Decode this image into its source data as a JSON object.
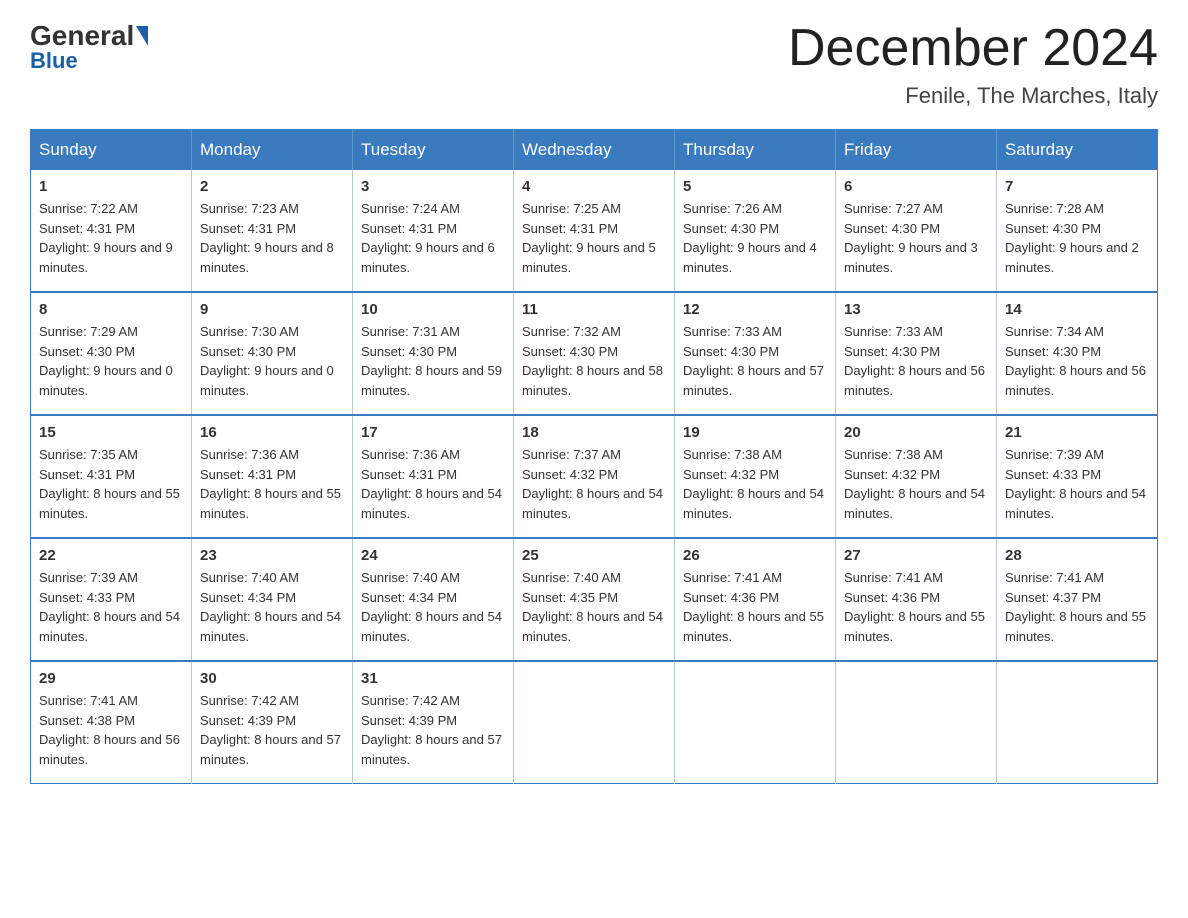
{
  "header": {
    "logo_general": "General",
    "logo_blue": "Blue",
    "month_year": "December 2024",
    "location": "Fenile, The Marches, Italy"
  },
  "days_of_week": [
    "Sunday",
    "Monday",
    "Tuesday",
    "Wednesday",
    "Thursday",
    "Friday",
    "Saturday"
  ],
  "weeks": [
    [
      {
        "day": "1",
        "sunrise": "7:22 AM",
        "sunset": "4:31 PM",
        "daylight": "9 hours and 9 minutes."
      },
      {
        "day": "2",
        "sunrise": "7:23 AM",
        "sunset": "4:31 PM",
        "daylight": "9 hours and 8 minutes."
      },
      {
        "day": "3",
        "sunrise": "7:24 AM",
        "sunset": "4:31 PM",
        "daylight": "9 hours and 6 minutes."
      },
      {
        "day": "4",
        "sunrise": "7:25 AM",
        "sunset": "4:31 PM",
        "daylight": "9 hours and 5 minutes."
      },
      {
        "day": "5",
        "sunrise": "7:26 AM",
        "sunset": "4:30 PM",
        "daylight": "9 hours and 4 minutes."
      },
      {
        "day": "6",
        "sunrise": "7:27 AM",
        "sunset": "4:30 PM",
        "daylight": "9 hours and 3 minutes."
      },
      {
        "day": "7",
        "sunrise": "7:28 AM",
        "sunset": "4:30 PM",
        "daylight": "9 hours and 2 minutes."
      }
    ],
    [
      {
        "day": "8",
        "sunrise": "7:29 AM",
        "sunset": "4:30 PM",
        "daylight": "9 hours and 0 minutes."
      },
      {
        "day": "9",
        "sunrise": "7:30 AM",
        "sunset": "4:30 PM",
        "daylight": "9 hours and 0 minutes."
      },
      {
        "day": "10",
        "sunrise": "7:31 AM",
        "sunset": "4:30 PM",
        "daylight": "8 hours and 59 minutes."
      },
      {
        "day": "11",
        "sunrise": "7:32 AM",
        "sunset": "4:30 PM",
        "daylight": "8 hours and 58 minutes."
      },
      {
        "day": "12",
        "sunrise": "7:33 AM",
        "sunset": "4:30 PM",
        "daylight": "8 hours and 57 minutes."
      },
      {
        "day": "13",
        "sunrise": "7:33 AM",
        "sunset": "4:30 PM",
        "daylight": "8 hours and 56 minutes."
      },
      {
        "day": "14",
        "sunrise": "7:34 AM",
        "sunset": "4:30 PM",
        "daylight": "8 hours and 56 minutes."
      }
    ],
    [
      {
        "day": "15",
        "sunrise": "7:35 AM",
        "sunset": "4:31 PM",
        "daylight": "8 hours and 55 minutes."
      },
      {
        "day": "16",
        "sunrise": "7:36 AM",
        "sunset": "4:31 PM",
        "daylight": "8 hours and 55 minutes."
      },
      {
        "day": "17",
        "sunrise": "7:36 AM",
        "sunset": "4:31 PM",
        "daylight": "8 hours and 54 minutes."
      },
      {
        "day": "18",
        "sunrise": "7:37 AM",
        "sunset": "4:32 PM",
        "daylight": "8 hours and 54 minutes."
      },
      {
        "day": "19",
        "sunrise": "7:38 AM",
        "sunset": "4:32 PM",
        "daylight": "8 hours and 54 minutes."
      },
      {
        "day": "20",
        "sunrise": "7:38 AM",
        "sunset": "4:32 PM",
        "daylight": "8 hours and 54 minutes."
      },
      {
        "day": "21",
        "sunrise": "7:39 AM",
        "sunset": "4:33 PM",
        "daylight": "8 hours and 54 minutes."
      }
    ],
    [
      {
        "day": "22",
        "sunrise": "7:39 AM",
        "sunset": "4:33 PM",
        "daylight": "8 hours and 54 minutes."
      },
      {
        "day": "23",
        "sunrise": "7:40 AM",
        "sunset": "4:34 PM",
        "daylight": "8 hours and 54 minutes."
      },
      {
        "day": "24",
        "sunrise": "7:40 AM",
        "sunset": "4:34 PM",
        "daylight": "8 hours and 54 minutes."
      },
      {
        "day": "25",
        "sunrise": "7:40 AM",
        "sunset": "4:35 PM",
        "daylight": "8 hours and 54 minutes."
      },
      {
        "day": "26",
        "sunrise": "7:41 AM",
        "sunset": "4:36 PM",
        "daylight": "8 hours and 55 minutes."
      },
      {
        "day": "27",
        "sunrise": "7:41 AM",
        "sunset": "4:36 PM",
        "daylight": "8 hours and 55 minutes."
      },
      {
        "day": "28",
        "sunrise": "7:41 AM",
        "sunset": "4:37 PM",
        "daylight": "8 hours and 55 minutes."
      }
    ],
    [
      {
        "day": "29",
        "sunrise": "7:41 AM",
        "sunset": "4:38 PM",
        "daylight": "8 hours and 56 minutes."
      },
      {
        "day": "30",
        "sunrise": "7:42 AM",
        "sunset": "4:39 PM",
        "daylight": "8 hours and 57 minutes."
      },
      {
        "day": "31",
        "sunrise": "7:42 AM",
        "sunset": "4:39 PM",
        "daylight": "8 hours and 57 minutes."
      },
      null,
      null,
      null,
      null
    ]
  ],
  "labels": {
    "sunrise": "Sunrise:",
    "sunset": "Sunset:",
    "daylight": "Daylight:"
  }
}
